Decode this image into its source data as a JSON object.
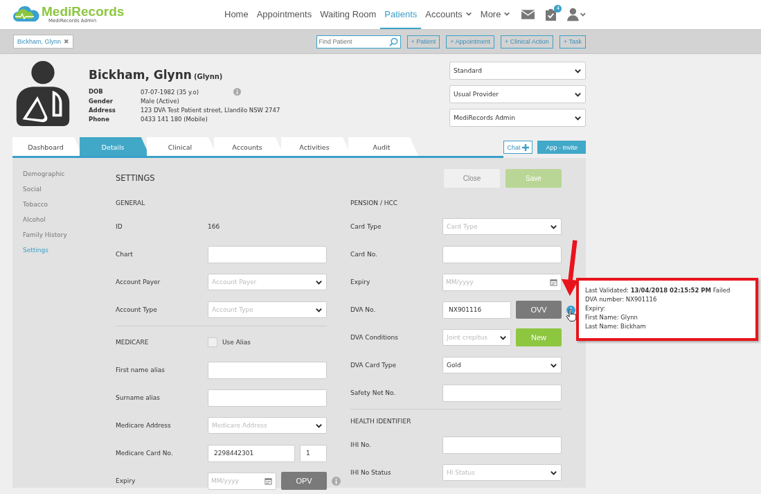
{
  "logo": {
    "name": "MediRecords",
    "subtitle": "MediRecords Admin"
  },
  "nav": [
    {
      "label": "Home",
      "selected": false,
      "dropdown": false
    },
    {
      "label": "Appointments",
      "selected": false,
      "dropdown": false
    },
    {
      "label": "Waiting Room",
      "selected": false,
      "dropdown": false
    },
    {
      "label": "Patients",
      "selected": true,
      "dropdown": false
    },
    {
      "label": "Accounts",
      "selected": false,
      "dropdown": true
    },
    {
      "label": "More",
      "selected": false,
      "dropdown": true
    }
  ],
  "tasks_badge": "4",
  "patient_tab": {
    "label": "Bickham, Glynn",
    "close": "✖"
  },
  "search": {
    "placeholder": "Find Patient"
  },
  "quick_buttons": [
    "+ Patient",
    "+ Appointment",
    "+ Clinical Action",
    "+ Task"
  ],
  "patient": {
    "name": "Bickham, Glynn",
    "preferred": "(Glynn)",
    "details": [
      {
        "label": "DOB",
        "value": "07-07-1982 (35 y.o)",
        "info": true
      },
      {
        "label": "Gender",
        "value": "Male (Active)"
      },
      {
        "label": "Address",
        "value": "123 DVA Test Patient street, Llandilo NSW 2747"
      },
      {
        "label": "Phone",
        "value": "0433 141 180 (Mobile)"
      }
    ]
  },
  "patient_selects": [
    "Standard",
    "Usual Provider",
    "MediRecords Admin"
  ],
  "tabs": [
    {
      "label": "Dashboard",
      "selected": false
    },
    {
      "label": "Details",
      "selected": true
    },
    {
      "label": "Clinical",
      "selected": false
    },
    {
      "label": "Accounts",
      "selected": false
    },
    {
      "label": "Activities",
      "selected": false
    },
    {
      "label": "Audit",
      "selected": false
    }
  ],
  "chat_button": "Chat",
  "invite_button": "App - Invite",
  "sidebar": [
    {
      "label": "Demographic",
      "selected": false
    },
    {
      "label": "Social",
      "selected": false
    },
    {
      "label": "Tobacco",
      "selected": false
    },
    {
      "label": "Alcohol",
      "selected": false
    },
    {
      "label": "Family History",
      "selected": false
    },
    {
      "label": "Settings",
      "selected": true
    }
  ],
  "settings": {
    "title": "SETTINGS",
    "close_button": "Close",
    "save_button": "Save",
    "left_column": [
      {
        "kind": "heading",
        "label": "GENERAL"
      },
      {
        "kind": "static",
        "label": "ID",
        "value": "166"
      },
      {
        "kind": "text",
        "label": "Chart"
      },
      {
        "kind": "select",
        "label": "Account Payer",
        "placeholder": "Account Payer"
      },
      {
        "kind": "select",
        "label": "Account Type",
        "placeholder": "Account Type"
      },
      {
        "kind": "divider"
      },
      {
        "kind": "checkbox",
        "label": "MEDICARE",
        "checkbox_label": "Use Alias",
        "checked": false
      },
      {
        "kind": "text",
        "label": "First name alias"
      },
      {
        "kind": "text",
        "label": "Surname alias"
      },
      {
        "kind": "select",
        "label": "Medicare Address",
        "placeholder": "Medicare Address"
      },
      {
        "kind": "pair",
        "label": "Medicare Card No.",
        "value": "2298442301",
        "second_value": "1"
      },
      {
        "kind": "date",
        "label": "Expiry",
        "placeholder": "MM/yyyy",
        "button": {
          "label": "OPV",
          "kind": "neutral"
        },
        "info": {
          "highlighted": false
        }
      }
    ],
    "right_column": [
      {
        "kind": "heading",
        "label": "PENSION / HCC"
      },
      {
        "kind": "select",
        "label": "Card Type",
        "placeholder": "Card Type"
      },
      {
        "kind": "text",
        "label": "Card No."
      },
      {
        "kind": "date",
        "label": "Expiry",
        "placeholder": "MM/yyyy"
      },
      {
        "kind": "text",
        "label": "DVA No.",
        "value": "NX901116",
        "button": {
          "label": "OVV",
          "kind": "neutral"
        },
        "info": {
          "highlighted": true
        }
      },
      {
        "kind": "select",
        "label": "DVA Conditions",
        "placeholder": "Joint crepitus",
        "button": {
          "label": "New",
          "kind": "primary"
        }
      },
      {
        "kind": "select",
        "label": "DVA Card Type",
        "value": "Gold"
      },
      {
        "kind": "text",
        "label": "Safety Net No."
      },
      {
        "kind": "divider"
      },
      {
        "kind": "heading",
        "label": "HEALTH IDENTIFIER"
      },
      {
        "kind": "text",
        "label": "IHI No."
      },
      {
        "kind": "select",
        "label": "IHI No Status",
        "placeholder": "HI Status"
      }
    ]
  },
  "tooltip": {
    "lines": [
      "Last Validated: **13/04/2018 02:15:52 PM** Failed",
      "DVA number: NX901116",
      "Expiry:",
      "First Name: Glynn",
      "Last Name: Bickham"
    ]
  }
}
